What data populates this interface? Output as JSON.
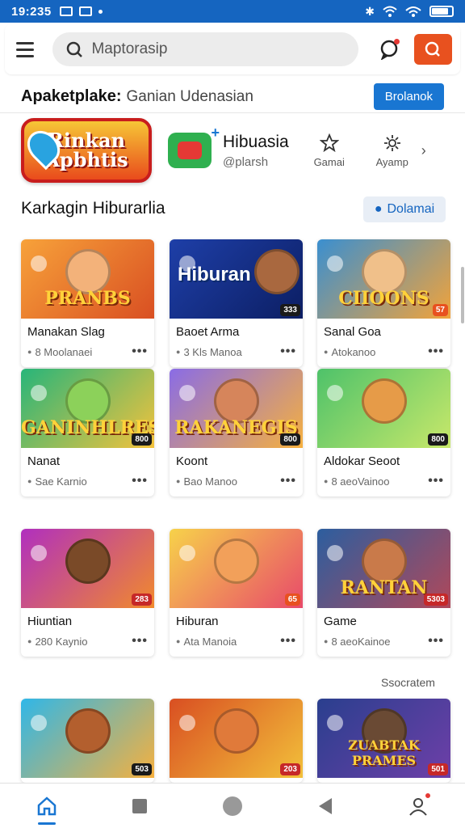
{
  "status_bar": {
    "time": "19:235"
  },
  "app_bar": {
    "search_placeholder": "Maptorasip"
  },
  "store_header": {
    "title": "Apaketplake:",
    "subtitle": "Ganian Udenasian",
    "button_label": "Brolanok"
  },
  "featured": {
    "logo_text": "Rinkan Apbhtis",
    "app_name": "Hibuasia",
    "app_sub": "@plarsh",
    "actions": [
      {
        "label": "Gamai",
        "icon": "star-icon"
      },
      {
        "label": "Ayamp",
        "icon": "gear-icon"
      }
    ]
  },
  "section": {
    "title": "Karkagin Hiburarlia",
    "button_label": "Dolamai"
  },
  "cards": [
    {
      "title": "Manakan Slag",
      "meta": "8 Moolanaei",
      "art_text": "PRANBS",
      "badge": "",
      "badge_color": ""
    },
    {
      "title": "Baoet Arma",
      "meta": "3 Kls Manoa",
      "art_text": "Hiburan",
      "badge": "333",
      "badge_color": "#1a1a1a"
    },
    {
      "title": "Sanal Goa",
      "meta": "Atokanoo",
      "art_text": "CIIOONS",
      "badge": "57",
      "badge_color": "#e8511f"
    },
    {
      "title": "Nanat",
      "meta": "Sae Karnio",
      "art_text": "GANINHLRES",
      "badge": "800",
      "badge_color": "#1a1a1a"
    },
    {
      "title": "Koont",
      "meta": "Bao Manoo",
      "art_text": "RAKANEGIS",
      "badge": "800",
      "badge_color": "#1a1a1a"
    },
    {
      "title": "Aldokar Seoot",
      "meta": "8 aeoVainoo",
      "art_text": "",
      "badge": "800",
      "badge_color": "#1a1a1a"
    },
    {
      "title": "Hiuntian",
      "meta": "280 Kaynio",
      "art_text": "",
      "badge": "283",
      "badge_color": "#c62828"
    },
    {
      "title": "Hiburan",
      "meta": "Ata Manoia",
      "art_text": "",
      "badge": "65",
      "badge_color": "#e8511f"
    },
    {
      "title": "Game",
      "meta": "8 aeoKainoe",
      "art_text": "RANTAN",
      "badge": "5303",
      "badge_color": "#c62828"
    },
    {
      "title": "",
      "meta": "",
      "art_text": "",
      "badge": "503",
      "badge_color": "#1a1a1a"
    },
    {
      "title": "",
      "meta": "",
      "art_text": "",
      "badge": "203",
      "badge_color": "#c62828"
    },
    {
      "title": "",
      "meta": "",
      "art_text": "ZUABTAK PRAMES",
      "badge": "501",
      "badge_color": "#c62828"
    }
  ],
  "see_more": "Ssocratem"
}
